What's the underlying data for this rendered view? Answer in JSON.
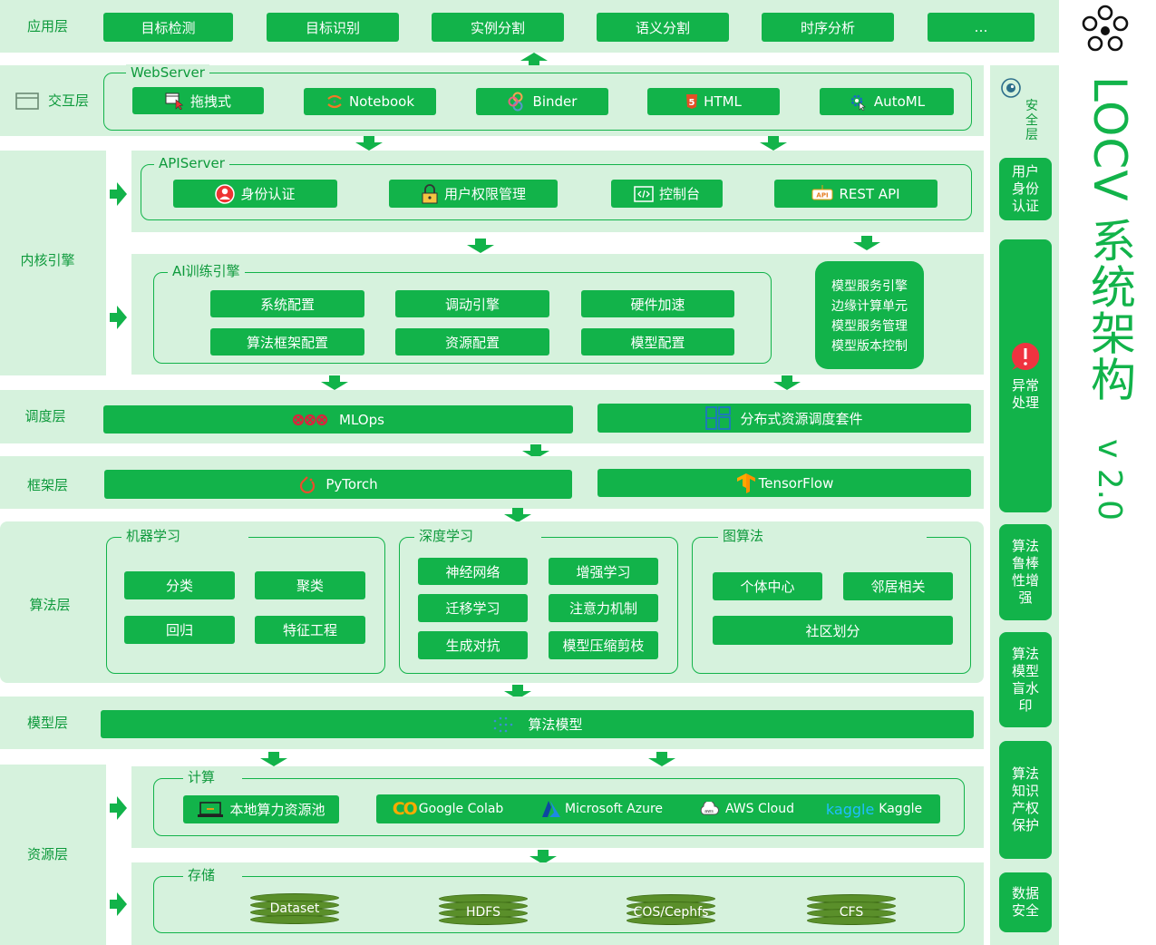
{
  "layers": {
    "app": "应用层",
    "interaction": "交互层",
    "kernel": "内核引擎",
    "scheduling": "调度层",
    "framework": "框架层",
    "algorithm": "算法层",
    "model": "模型层",
    "resource": "资源层"
  },
  "app_items": [
    "目标检测",
    "目标识别",
    "实例分割",
    "语义分割",
    "时序分析",
    "…"
  ],
  "webserver": {
    "title": "WebServer",
    "items": [
      "拖拽式",
      "Notebook",
      "Binder",
      "HTML",
      "AutoML"
    ]
  },
  "apiserver": {
    "title": "APIServer",
    "items": [
      "身份认证",
      "用户权限管理",
      "控制台",
      "REST API"
    ]
  },
  "ai_engine": {
    "title": "AI训练引擎",
    "items": [
      "系统配置",
      "调动引擎",
      "硬件加速",
      "算法框架配置",
      "资源配置",
      "模型配置"
    ]
  },
  "model_service": [
    "模型服务引擎",
    "边缘计算单元",
    "模型服务管理",
    "模型版本控制"
  ],
  "scheduling": [
    "MLOps",
    "分布式资源调度套件"
  ],
  "framework": [
    "PyTorch",
    "TensorFlow"
  ],
  "ml": {
    "title": "机器学习",
    "items": [
      "分类",
      "聚类",
      "回归",
      "特征工程"
    ]
  },
  "dl": {
    "title": "深度学习",
    "items": [
      "神经网络",
      "增强学习",
      "迁移学习",
      "注意力机制",
      "生成对抗",
      "模型压缩剪枝"
    ]
  },
  "graph": {
    "title": "图算法",
    "items": [
      "个体中心",
      "邻居相关",
      "社区划分"
    ]
  },
  "model": "算法模型",
  "compute": {
    "title": "计算",
    "local": "本地算力资源池",
    "clouds": [
      "Google Colab",
      "Microsoft Azure",
      "AWS Cloud",
      "Kaggle"
    ],
    "kaggle_logo": "kaggle",
    "colab_logo": "CO"
  },
  "storage": {
    "title": "存储",
    "items": [
      "Dataset",
      "HDFS",
      "COS/Cephfs",
      "CFS"
    ]
  },
  "security": {
    "title": "安全层",
    "items": [
      "用户身份认证",
      "异常处理",
      "算法鲁棒性增强",
      "算法模型盲水印",
      "算法知识产权保护",
      "数据安全"
    ]
  },
  "brand": {
    "title": "LOCV 系统架构",
    "version": "v 2.0"
  },
  "colors": {
    "band": "#d6f2dd",
    "green": "#12b34a",
    "text": "#0e9a3c"
  }
}
